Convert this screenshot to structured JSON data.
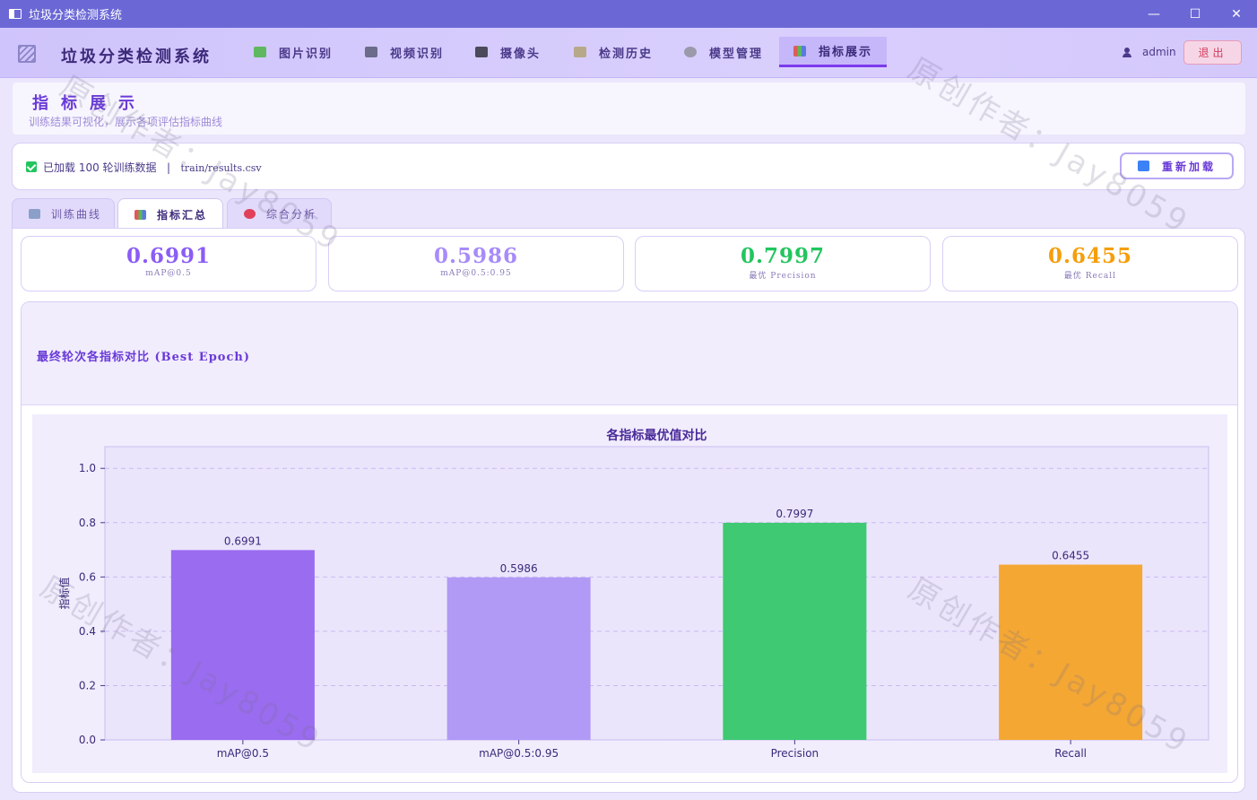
{
  "window": {
    "title": "垃圾分类检测系统",
    "controls": [
      "—",
      "☐",
      "✕"
    ]
  },
  "nav": {
    "brand": "垃圾分类检测系统",
    "items": [
      {
        "label": "图片识别",
        "icon": "image-icon",
        "color": "#5fb85f"
      },
      {
        "label": "视频识别",
        "icon": "film-icon",
        "color": "#6b6b8a"
      },
      {
        "label": "摄像头",
        "icon": "camera-icon",
        "color": "#4a4a5a"
      },
      {
        "label": "检测历史",
        "icon": "clipboard-icon",
        "color": "#b8a88a"
      },
      {
        "label": "模型管理",
        "icon": "gear-icon",
        "color": "#9a9aaa"
      },
      {
        "label": "指标展示",
        "icon": "bar-chart-icon",
        "color": "#e05a5a"
      }
    ],
    "user": "admin",
    "logout": "退出"
  },
  "header": {
    "title": "指标展示",
    "subtitle": "训练结果可视化，展示各项评估指标曲线"
  },
  "status": {
    "loaded_text": "已加载 100 轮训练数据",
    "separator": "|",
    "file_path": "train/results.csv",
    "reload_label": "重新加载"
  },
  "tabs": [
    {
      "label": "训练曲线",
      "icon": "line-chart-icon"
    },
    {
      "label": "指标汇总",
      "icon": "bar-chart-icon"
    },
    {
      "label": "综合分析",
      "icon": "target-icon"
    }
  ],
  "kpis": [
    {
      "value": "0.6991",
      "label": "mAP@0.5",
      "color": "#8b5cf6"
    },
    {
      "value": "0.5986",
      "label": "mAP@0.5:0.95",
      "color": "#a78bfa"
    },
    {
      "value": "0.7997",
      "label": "最优 Precision",
      "color": "#22c55e"
    },
    {
      "value": "0.6455",
      "label": "最优 Recall",
      "color": "#f59e0b"
    }
  ],
  "chart_section": {
    "title": "最终轮次各指标对比 (Best Epoch)"
  },
  "chart_data": {
    "type": "bar",
    "title": "各指标最优值对比",
    "xlabel": "",
    "ylabel": "指标值",
    "categories": [
      "mAP@0.5",
      "mAP@0.5:0.95",
      "Precision",
      "Recall"
    ],
    "values": [
      0.6991,
      0.5986,
      0.7997,
      0.6455
    ],
    "value_labels": [
      "0.6991",
      "0.5986",
      "0.7997",
      "0.6455"
    ],
    "colors": [
      "#9a6cf0",
      "#b199f6",
      "#3ec972",
      "#f4a733"
    ],
    "ylim": [
      0,
      1.08
    ],
    "yticks": [
      0.0,
      0.2,
      0.4,
      0.6,
      0.8,
      1.0
    ],
    "ytick_labels": [
      "0.0",
      "0.2",
      "0.4",
      "0.6",
      "0.8",
      "1.0"
    ],
    "grid": true,
    "grid_axis": "y"
  },
  "watermark": "原创作者：Jay8059"
}
